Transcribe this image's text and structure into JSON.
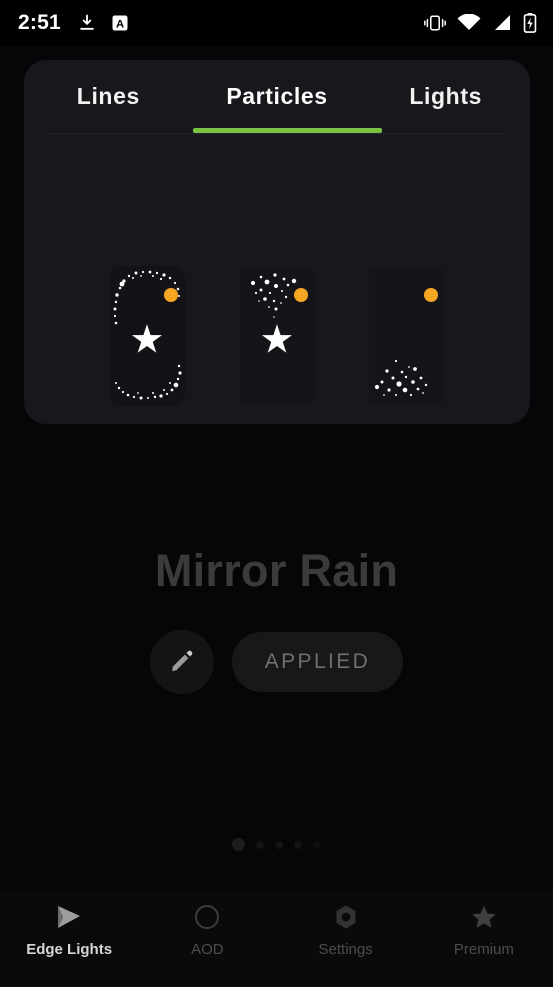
{
  "status_bar": {
    "clock": "2:51",
    "left_icons": [
      "download-icon",
      "a-letter-icon"
    ],
    "right_icons": [
      "vibrate-icon",
      "wifi-icon",
      "signal-icon",
      "battery-charging-icon"
    ]
  },
  "tabs": [
    {
      "label": "Lines",
      "selected": false
    },
    {
      "label": "Particles",
      "selected": true
    },
    {
      "label": "Lights",
      "selected": false
    }
  ],
  "accent": {
    "tab_indicator": "#7cc242",
    "premium_badge": "#f5a623"
  },
  "previews": [
    {
      "name": "dotted-border-star",
      "badge": true,
      "star": true
    },
    {
      "name": "top-burst-star",
      "badge": true,
      "star": true
    },
    {
      "name": "bottom-sparkle",
      "badge": true,
      "star": false
    }
  ],
  "effect": {
    "title": "Mirror Rain",
    "edit_label": "edit-icon",
    "apply_label": "APPLIED"
  },
  "pager": {
    "count": 5,
    "active_index": 0
  },
  "bottom_nav": [
    {
      "label": "Edge Lights",
      "icon": "edge-lights-icon",
      "active": true
    },
    {
      "label": "AOD",
      "icon": "moon-clock-icon",
      "active": false
    },
    {
      "label": "Settings",
      "icon": "gear-icon",
      "active": false
    },
    {
      "label": "Premium",
      "icon": "star-icon",
      "active": false
    }
  ]
}
